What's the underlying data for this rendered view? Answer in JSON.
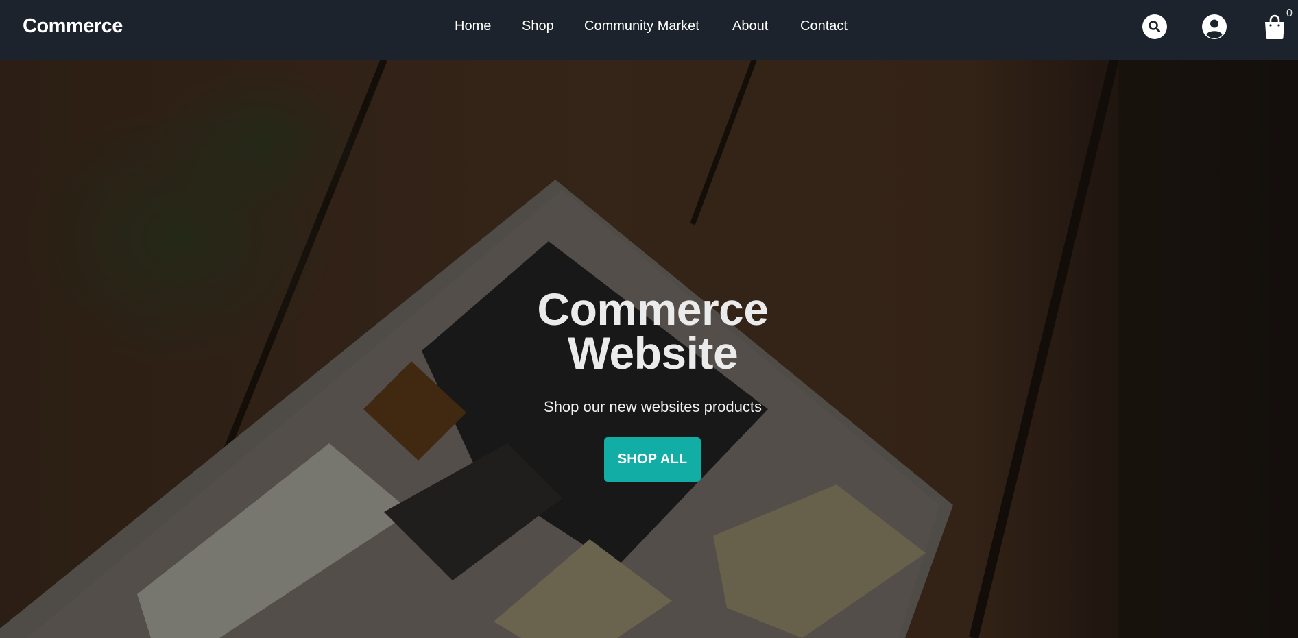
{
  "brand": "Commerce",
  "nav": {
    "home": "Home",
    "shop": "Shop",
    "community": "Community Market",
    "about": "About",
    "contact": "Contact"
  },
  "icons": {
    "search": "search-icon",
    "account": "user-account-icon",
    "cart": "shopping-bag-icon"
  },
  "cart": {
    "count": "0"
  },
  "hero": {
    "title": "Commerce Website",
    "subtitle": "Shop our new websites products",
    "button_label": "SHOP ALL",
    "background": "keyboard-on-wooden-table-photo"
  },
  "colors": {
    "navbar": "#1c232c",
    "accent": "#12ada5",
    "text": "#ffffff"
  }
}
